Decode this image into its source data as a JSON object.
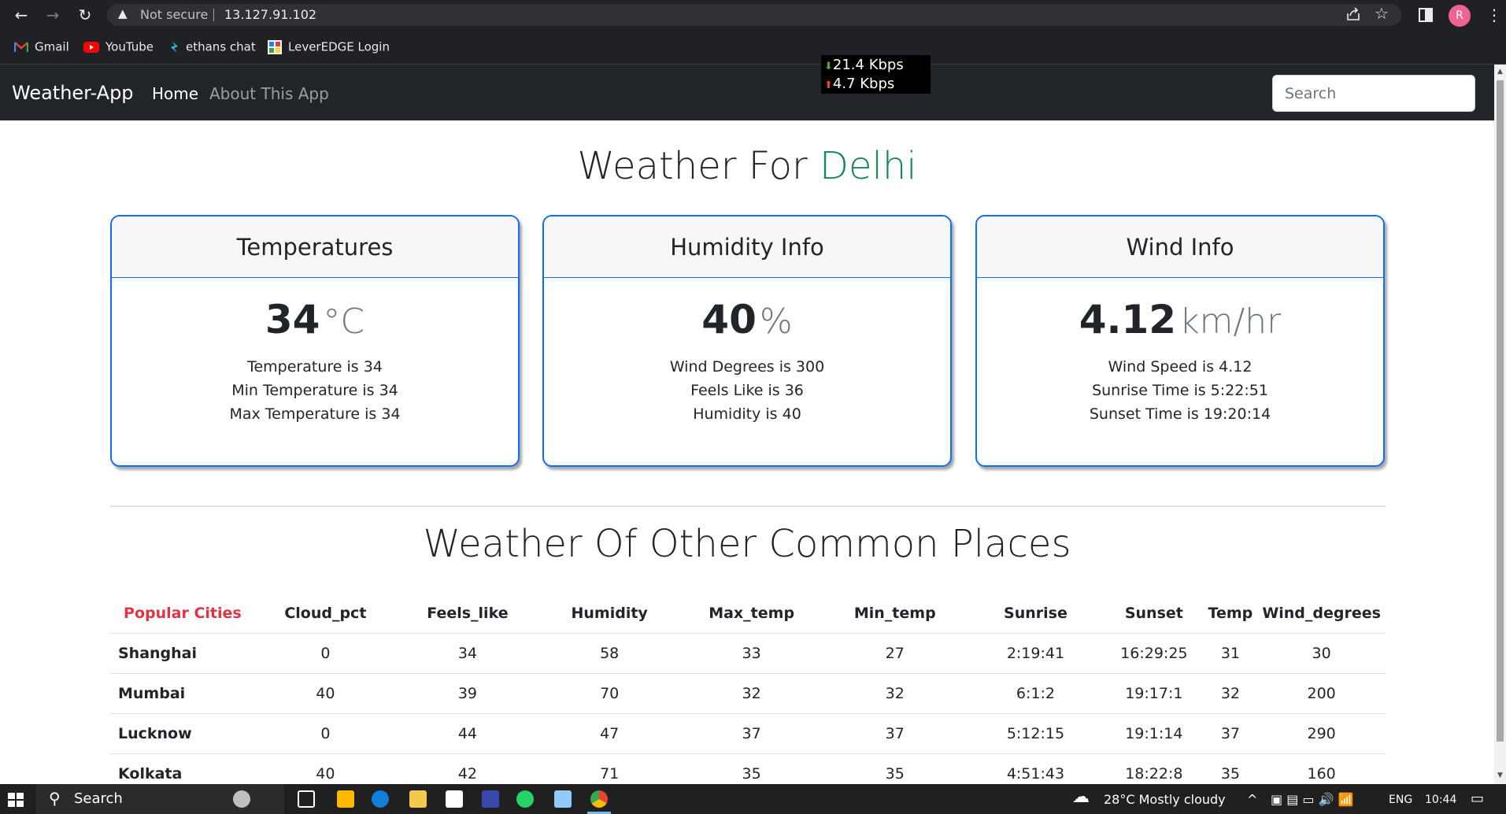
{
  "browser": {
    "url_warning": "Not secure",
    "url": "13.127.91.102",
    "avatar_letter": "R",
    "bookmarks": [
      {
        "label": "Gmail"
      },
      {
        "label": "YouTube"
      },
      {
        "label": "ethans chat"
      },
      {
        "label": "LeverEDGE Login"
      }
    ]
  },
  "speed": {
    "down": "21.4 Kbps",
    "up": "4.7 Kbps"
  },
  "navbar": {
    "brand": "Weather-App",
    "links": [
      "Home",
      "About This App"
    ],
    "search_placeholder": "Search"
  },
  "main": {
    "title_prefix": "Weather For",
    "city": "Delhi",
    "cards": [
      {
        "header": "Temperatures",
        "value": "34",
        "unit": "°C",
        "lines": [
          "Temperature is 34",
          "Min Temperature is 34",
          "Max Temperature is 34"
        ]
      },
      {
        "header": "Humidity Info",
        "value": "40",
        "unit": "%",
        "lines": [
          "Wind Degrees is 300",
          "Feels Like is 36",
          "Humidity is 40"
        ]
      },
      {
        "header": "Wind Info",
        "value": "4.12",
        "unit": "km/hr",
        "lines": [
          "Wind Speed is 4.12",
          "Sunrise Time is 5:22:51",
          "Sunset Time is 19:20:14"
        ]
      }
    ],
    "other_title": "Weather Of Other Common Places"
  },
  "table": {
    "headers": [
      "Popular Cities",
      "Cloud_pct",
      "Feels_like",
      "Humidity",
      "Max_temp",
      "Min_temp",
      "Sunrise",
      "Sunset",
      "Temp",
      "Wind_degrees"
    ],
    "rows": [
      [
        "Shanghai",
        "0",
        "34",
        "58",
        "33",
        "27",
        "2:19:41",
        "16:29:25",
        "31",
        "30"
      ],
      [
        "Mumbai",
        "40",
        "39",
        "70",
        "32",
        "32",
        "6:1:2",
        "19:17:1",
        "32",
        "200"
      ],
      [
        "Lucknow",
        "0",
        "44",
        "47",
        "37",
        "37",
        "5:12:15",
        "19:1:14",
        "37",
        "290"
      ],
      [
        "Kolkata",
        "40",
        "42",
        "71",
        "35",
        "35",
        "4:51:43",
        "18:22:8",
        "35",
        "160"
      ]
    ]
  },
  "taskbar": {
    "search": "Search",
    "weather": "28°C  Mostly cloudy",
    "lang": "ENG",
    "time": "10:44"
  },
  "colors": {
    "city_accent": "#198754",
    "card_border": "#0d6efd",
    "popular_cities": "#dc3545",
    "navbar_bg": "#212529"
  }
}
